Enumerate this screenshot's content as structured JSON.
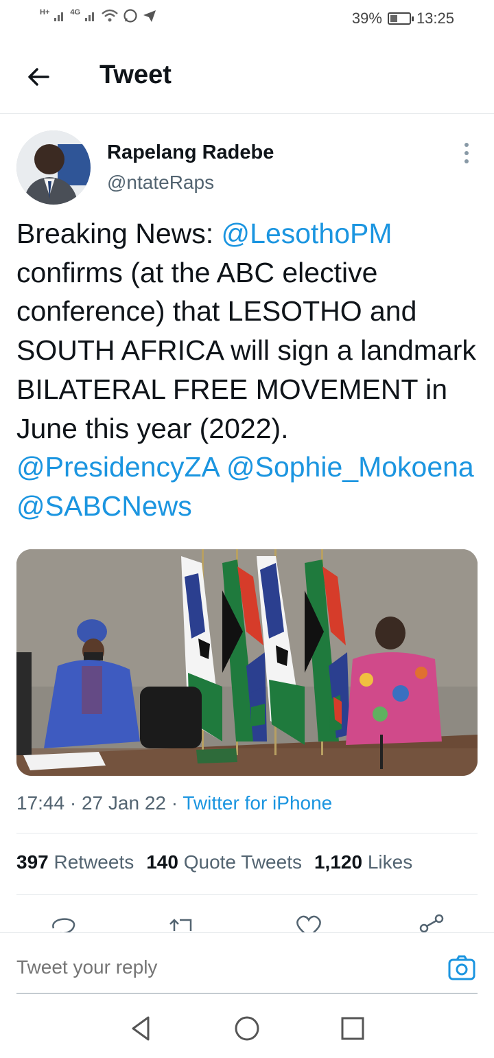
{
  "status_bar": {
    "network_left": "H+",
    "network_right": "4G",
    "battery": "39%",
    "battery_level": 0.39,
    "time": "13:25"
  },
  "header": {
    "title": "Tweet"
  },
  "tweet": {
    "author_name": "Rapelang Radebe",
    "author_handle": "@ntateRaps",
    "text_parts": {
      "p1": "Breaking News: ",
      "m1": "@LesothoPM",
      "p2": " confirms (at the ABC elective conference) that LESOTHO and SOUTH AFRICA will sign a landmark BILATERAL FREE MOVEMENT in June this year (2022). ",
      "m2": "@PresidencyZA",
      "p3": " ",
      "m3": "@Sophie_Mokoena",
      "p4": " ",
      "m4": "@SABCNews"
    },
    "time": "17:44",
    "date": "27 Jan 22",
    "separator": " · ",
    "source": "Twitter for iPhone"
  },
  "stats": {
    "retweets_count": "397",
    "retweets_label": "Retweets",
    "quotes_count": "140",
    "quotes_label": "Quote Tweets",
    "likes_count": "1,120",
    "likes_label": "Likes"
  },
  "reply": {
    "placeholder": "Tweet your reply"
  },
  "colors": {
    "accent": "#1b95e0",
    "text": "#0f1419",
    "muted": "#536471"
  },
  "icons": [
    "back-arrow-icon",
    "more-vertical-icon",
    "reply-icon",
    "retweet-icon",
    "like-icon",
    "share-icon",
    "camera-icon",
    "nav-back-icon",
    "nav-home-icon",
    "nav-recents-icon"
  ]
}
